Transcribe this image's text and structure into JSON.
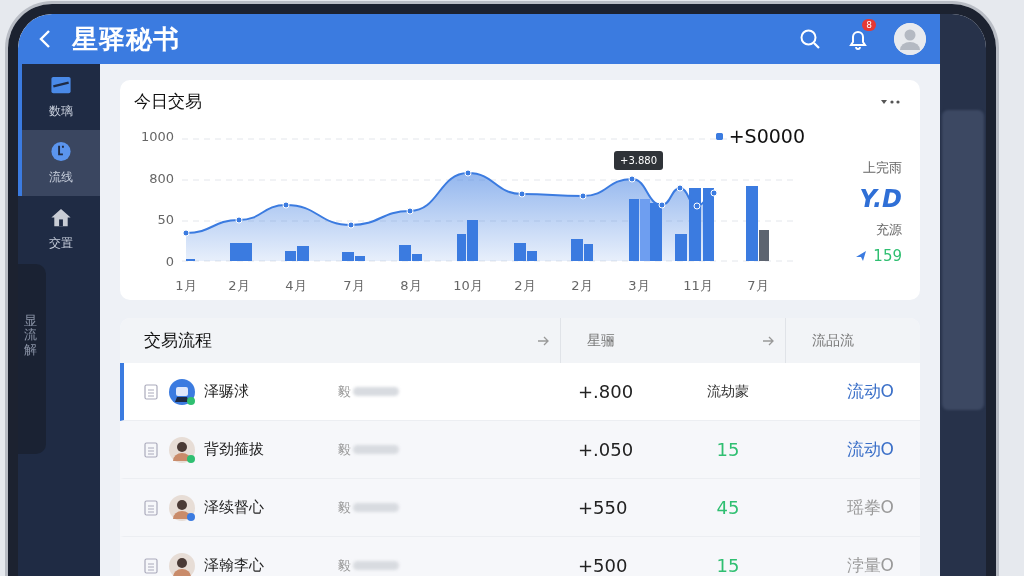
{
  "app": {
    "title": "星驿秘书",
    "notification_badge": "8"
  },
  "sidebar": {
    "items": [
      {
        "label": "数璃",
        "kind": "card",
        "selected": false
      },
      {
        "label": "流线",
        "kind": "clock",
        "selected": true
      },
      {
        "label": "交置",
        "kind": "home",
        "selected": false
      }
    ],
    "side_tab": "显流解"
  },
  "chart_card": {
    "title": "今日交易",
    "legend": "+S0000",
    "tooltip": "+3.880",
    "y_axis_labels": [
      "1000",
      "800",
      "50",
      "0"
    ],
    "x_axis_labels": [
      "1月",
      "2月",
      "4月",
      "7月",
      "8月",
      "10月",
      "2月",
      "2月",
      "3月",
      "11月",
      "7月"
    ],
    "stats": [
      {
        "label": "上完雨",
        "value": "Y.D",
        "kind": "big"
      },
      {
        "label": "充源",
        "value": "159",
        "kind": "trend"
      }
    ]
  },
  "table": {
    "title": "交易流程",
    "columns": [
      "星骊",
      "流品流"
    ],
    "rows": [
      {
        "name": "泽骣浗",
        "avatar": {
          "kind": "bot",
          "color": "#2fbf71"
        },
        "detail": "毅",
        "amount": "+.800",
        "column_4": {
          "text": "流劫蒙",
          "kind": "text"
        },
        "status": {
          "text": "流动O",
          "kind": "active"
        },
        "selected": true
      },
      {
        "name": "背劲箍拔",
        "avatar": {
          "kind": "person",
          "color": "#2fbf71"
        },
        "detail": "毅",
        "amount": "+.050",
        "column_4": {
          "text": "15",
          "kind": "number"
        },
        "status": {
          "text": "流动O",
          "kind": "active"
        },
        "selected": false
      },
      {
        "name": "泽续督心",
        "avatar": {
          "kind": "person",
          "color": "#3b7be0"
        },
        "detail": "毅",
        "amount": "+550",
        "column_4": {
          "text": "45",
          "kind": "number"
        },
        "status": {
          "text": "瑶拳O",
          "kind": "muted"
        },
        "selected": false
      },
      {
        "name": "泽翰李心",
        "avatar": {
          "kind": "person"
        },
        "detail": "毅",
        "amount": "+500",
        "column_4": {
          "text": "15",
          "kind": "number"
        },
        "status": {
          "text": "浡量O",
          "kind": "muted"
        },
        "selected": false
      }
    ]
  }
}
